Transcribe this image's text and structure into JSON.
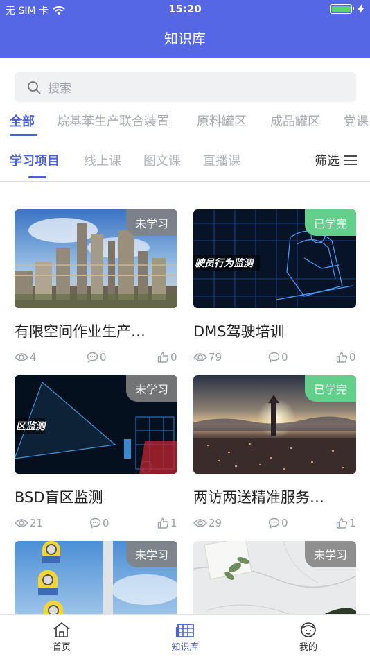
{
  "status_bar": {
    "carrier": "无 SIM 卡",
    "time": "15:20"
  },
  "header": {
    "title": "知识库"
  },
  "search": {
    "placeholder": "搜索"
  },
  "categories": [
    "全部",
    "烷基苯生产联合装置",
    "原料罐区",
    "成品罐区",
    "党课"
  ],
  "subtabs": [
    "学习项目",
    "线上课",
    "图文课",
    "直播课"
  ],
  "filter": {
    "label": "筛选"
  },
  "cards": [
    {
      "title": "有限空间作业生产…",
      "badge": "未学习",
      "views": "4",
      "comments": "0",
      "likes": "0",
      "image": "refinery-photo",
      "overlay_text": ""
    },
    {
      "title": "DMS驾驶培训",
      "badge": "已学完",
      "views": "79",
      "comments": "0",
      "likes": "0",
      "image": "driver-wireframe",
      "overlay_text": "驶员行为监测"
    },
    {
      "title": "BSD盲区监测",
      "badge": "未学习",
      "views": "21",
      "comments": "0",
      "likes": "1",
      "image": "truck-wireframe",
      "overlay_text": "区监测"
    },
    {
      "title": "两访两送精准服务…",
      "badge": "已学完",
      "views": "29",
      "comments": "0",
      "likes": "1",
      "image": "city-sunset",
      "overlay_text": ""
    },
    {
      "title": "",
      "badge": "未学习",
      "views": "",
      "comments": "",
      "likes": "",
      "image": "minions-photo",
      "overlay_text": ""
    },
    {
      "title": "",
      "badge": "未学习",
      "views": "",
      "comments": "",
      "likes": "",
      "image": "marble-plant",
      "overlay_text": ""
    }
  ],
  "bottom_nav": [
    {
      "label": "首页",
      "icon": "home-icon"
    },
    {
      "label": "知识库",
      "icon": "library-icon"
    },
    {
      "label": "我的",
      "icon": "profile-icon"
    }
  ],
  "colors": {
    "primary": "#5567e4",
    "accent": "#4a5fe0",
    "badge_done": "#62cf8a",
    "badge_todo": "#828282"
  }
}
